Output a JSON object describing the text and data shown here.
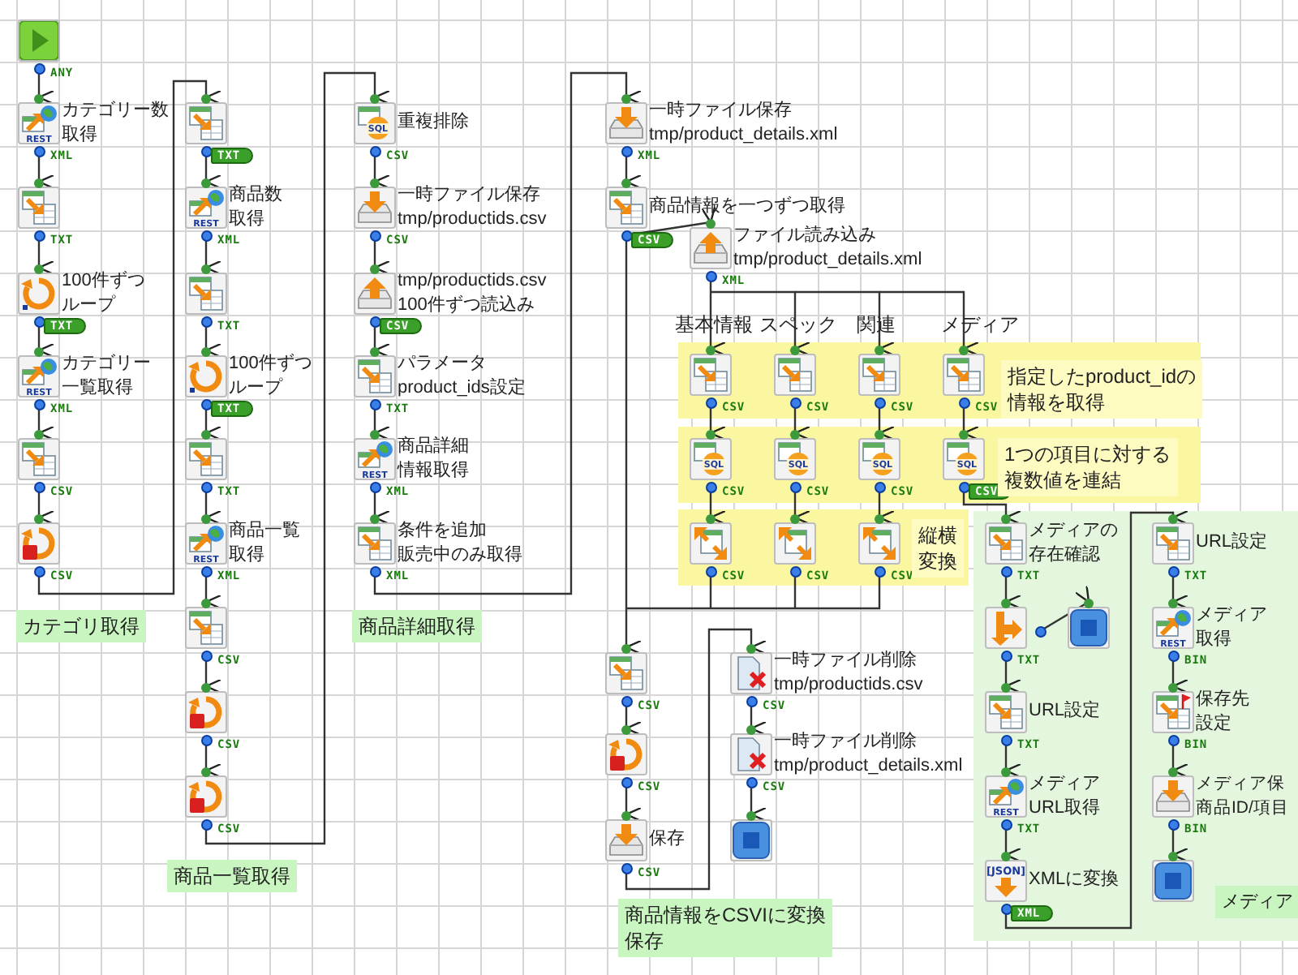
{
  "nodes": [
    {
      "kind": "start",
      "port": {
        "text": "ANY",
        "tagged": false
      }
    },
    {
      "kind": "rest",
      "icon_text": "REST",
      "lines": [
        "カテゴリー数",
        "取得"
      ],
      "port": {
        "text": "XML",
        "tagged": false
      }
    },
    {
      "kind": "table",
      "port": {
        "text": "TXT",
        "tagged": false
      }
    },
    {
      "kind": "loop",
      "lines": [
        "100件ずつ",
        "ループ"
      ],
      "port": {
        "text": "TXT",
        "tagged": true
      }
    },
    {
      "kind": "rest",
      "icon_text": "REST",
      "lines": [
        "カテゴリー",
        "一覧取得"
      ],
      "port": {
        "text": "XML",
        "tagged": false
      }
    },
    {
      "kind": "table",
      "port": {
        "text": "CSV",
        "tagged": false
      }
    },
    {
      "kind": "loop_end",
      "port": {
        "text": "CSV",
        "tagged": false
      }
    },
    {
      "kind": "table",
      "port": {
        "text": "TXT",
        "tagged": true
      }
    },
    {
      "kind": "rest",
      "icon_text": "REST",
      "lines": [
        "商品数",
        "取得"
      ],
      "port": {
        "text": "XML",
        "tagged": false
      }
    },
    {
      "kind": "table",
      "port": {
        "text": "TXT",
        "tagged": false
      }
    },
    {
      "kind": "loop",
      "lines": [
        "100件ずつ",
        "ループ"
      ],
      "port": {
        "text": "TXT",
        "tagged": true
      }
    },
    {
      "kind": "table",
      "port": {
        "text": "TXT",
        "tagged": false
      }
    },
    {
      "kind": "rest",
      "icon_text": "REST",
      "lines": [
        "商品一覧",
        "取得"
      ],
      "port": {
        "text": "XML",
        "tagged": false
      }
    },
    {
      "kind": "table",
      "port": {
        "text": "CSV",
        "tagged": false
      }
    },
    {
      "kind": "loop_end",
      "port": {
        "text": "CSV",
        "tagged": false
      }
    },
    {
      "kind": "loop_end",
      "port": {
        "text": "CSV",
        "tagged": false
      }
    },
    {
      "kind": "sql",
      "icon_text": "SQL",
      "lines": [
        "重複排除"
      ],
      "port": {
        "text": "CSV",
        "tagged": false
      }
    },
    {
      "kind": "save",
      "lines": [
        "一時ファイル保存",
        "tmp/productids.csv"
      ],
      "port": {
        "text": "CSV",
        "tagged": false
      }
    },
    {
      "kind": "load",
      "lines": [
        "tmp/productids.csv",
        "100件ずつ読込み"
      ],
      "port": {
        "text": "CSV",
        "tagged": true
      }
    },
    {
      "kind": "table",
      "lines": [
        "パラメータ",
        "product_ids設定"
      ],
      "port": {
        "text": "TXT",
        "tagged": false
      }
    },
    {
      "kind": "rest",
      "icon_text": "REST",
      "lines": [
        "商品詳細",
        "情報取得"
      ],
      "port": {
        "text": "XML",
        "tagged": false
      }
    },
    {
      "kind": "table",
      "lines": [
        "条件を追加",
        "販売中のみ取得"
      ],
      "port": {
        "text": "XML",
        "tagged": false
      }
    },
    {
      "kind": "save",
      "lines": [
        "一時ファイル保存",
        "tmp/product_details.xml"
      ],
      "port": {
        "text": "XML",
        "tagged": false
      }
    },
    {
      "kind": "table",
      "lines": [
        "商品情報を一つずつ取得"
      ],
      "port": {
        "text": "CSV",
        "tagged": true
      }
    },
    {
      "kind": "load",
      "lines": [
        "ファイル読み込み",
        "tmp/product_details.xml"
      ],
      "port": {
        "text": "XML",
        "tagged": false
      }
    },
    {
      "kind": "table",
      "port": {
        "text": "CSV",
        "tagged": false
      }
    },
    {
      "kind": "table",
      "port": {
        "text": "CSV",
        "tagged": false
      }
    },
    {
      "kind": "table",
      "port": {
        "text": "CSV",
        "tagged": false
      }
    },
    {
      "kind": "table",
      "port": {
        "text": "CSV",
        "tagged": false
      }
    },
    {
      "kind": "sql",
      "icon_text": "SQL",
      "port": {
        "text": "CSV",
        "tagged": false
      }
    },
    {
      "kind": "sql",
      "icon_text": "SQL",
      "port": {
        "text": "CSV",
        "tagged": false
      }
    },
    {
      "kind": "sql",
      "icon_text": "SQL",
      "port": {
        "text": "CSV",
        "tagged": false
      }
    },
    {
      "kind": "sql",
      "icon_text": "SQL",
      "port": {
        "text": "CSV",
        "tagged": true
      }
    },
    {
      "kind": "merge",
      "port": {
        "text": "CSV",
        "tagged": false
      }
    },
    {
      "kind": "merge",
      "port": {
        "text": "CSV",
        "tagged": false
      }
    },
    {
      "kind": "merge",
      "port": {
        "text": "CSV",
        "tagged": false
      }
    },
    {
      "kind": "table",
      "port": {
        "text": "CSV",
        "tagged": false
      }
    },
    {
      "kind": "loop_end",
      "port": {
        "text": "CSV",
        "tagged": false
      }
    },
    {
      "kind": "save",
      "lines": [
        "保存"
      ],
      "port": {
        "text": "CSV",
        "tagged": false
      }
    },
    {
      "kind": "delete",
      "lines": [
        "一時ファイル削除",
        "tmp/productids.csv"
      ],
      "port": {
        "text": "CSV",
        "tagged": false
      }
    },
    {
      "kind": "delete",
      "lines": [
        "一時ファイル削除",
        "tmp/product_details.xml"
      ],
      "port": {
        "text": "CSV",
        "tagged": false
      }
    },
    {
      "kind": "end"
    },
    {
      "kind": "table",
      "lines": [
        "メディアの",
        "存在確認"
      ],
      "port": {
        "text": "TXT",
        "tagged": false
      }
    },
    {
      "kind": "branch",
      "port": {
        "text": "TXT",
        "tagged": false
      }
    },
    {
      "kind": "end"
    },
    {
      "kind": "table",
      "lines": [
        "URL設定"
      ],
      "port": {
        "text": "TXT",
        "tagged": false
      }
    },
    {
      "kind": "rest",
      "icon_text": "REST",
      "lines": [
        "メディア",
        "URL取得"
      ],
      "port": {
        "text": "TXT",
        "tagged": false
      }
    },
    {
      "kind": "json",
      "icon_text": "[JSON]",
      "lines": [
        "XMLに変換"
      ],
      "port": {
        "text": "XML",
        "tagged": true
      }
    },
    {
      "kind": "table",
      "lines": [
        "URL設定"
      ],
      "port": {
        "text": "TXT",
        "tagged": false
      }
    },
    {
      "kind": "rest",
      "icon_text": "REST",
      "lines": [
        "メディア",
        "取得"
      ],
      "port": {
        "text": "BIN",
        "tagged": false
      }
    },
    {
      "kind": "table_flag",
      "lines": [
        "保存先",
        "設定"
      ],
      "port": {
        "text": "BIN",
        "tagged": false
      }
    },
    {
      "kind": "save",
      "lines": [
        "メディア保",
        "商品ID/項目"
      ],
      "port": {
        "text": "BIN",
        "tagged": false
      }
    },
    {
      "kind": "end"
    }
  ],
  "branch_labels": [
    "基本情報",
    "スペック",
    "関連",
    "メディア"
  ],
  "notes": [
    {
      "lines": [
        "指定したproduct_idの",
        "情報を取得"
      ]
    },
    {
      "lines": [
        "1つの項目に対する",
        "複数値を連結"
      ]
    },
    {
      "lines": [
        "縦横",
        "変換"
      ]
    }
  ],
  "groups": [
    {
      "lines": [
        "カテゴリ取得"
      ]
    },
    {
      "lines": [
        "商品一覧取得"
      ]
    },
    {
      "lines": [
        "商品詳細取得"
      ]
    },
    {
      "lines": [
        "商品情報をCSVIに変換",
        "保存"
      ]
    },
    {
      "lines": [
        "メディア"
      ]
    }
  ]
}
